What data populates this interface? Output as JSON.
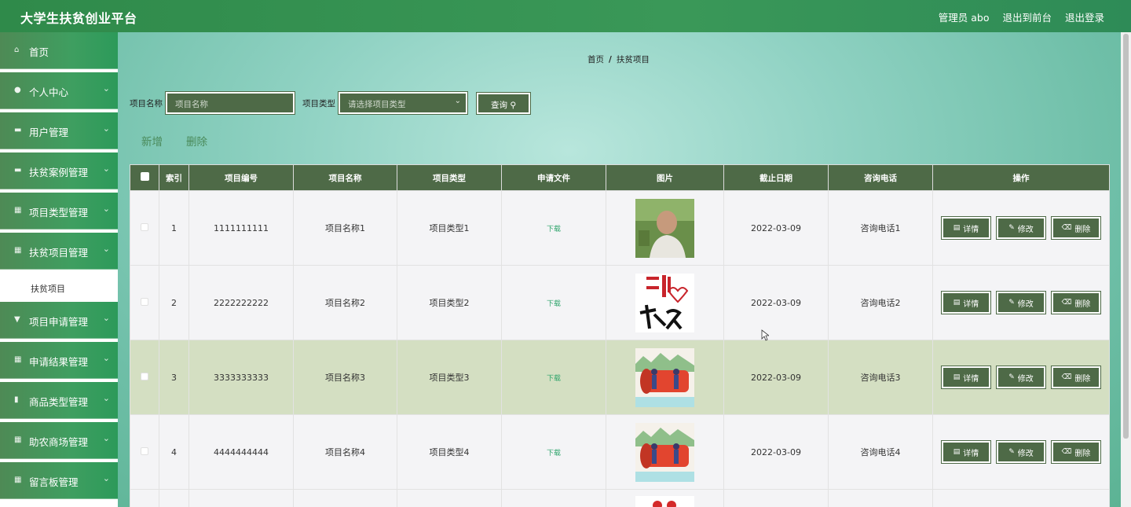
{
  "header": {
    "title": "大学生扶贫创业平台",
    "admin": "管理员 abo",
    "to_front": "退出到前台",
    "logout": "退出登录"
  },
  "sidebar": {
    "items": [
      {
        "label": "首页",
        "icon": "home-icon",
        "chev": false
      },
      {
        "label": "个人中心",
        "icon": "user-icon",
        "chev": true
      },
      {
        "label": "用户管理",
        "icon": "users-icon",
        "chev": true
      },
      {
        "label": "扶贫案例管理",
        "icon": "case-icon",
        "chev": true
      },
      {
        "label": "项目类型管理",
        "icon": "grid-icon",
        "chev": true
      },
      {
        "label": "扶贫项目管理",
        "icon": "grid-icon",
        "chev": true
      }
    ],
    "sub_item": "扶贫项目",
    "items_after": [
      {
        "label": "项目申请管理",
        "icon": "apply-icon",
        "chev": true
      },
      {
        "label": "申请结果管理",
        "icon": "grid-icon",
        "chev": true
      },
      {
        "label": "商品类型管理",
        "icon": "bag-icon",
        "chev": true
      },
      {
        "label": "助农商场管理",
        "icon": "grid-icon",
        "chev": true
      },
      {
        "label": "留言板管理",
        "icon": "grid-icon",
        "chev": true
      }
    ]
  },
  "breadcrumb": {
    "home": "首页",
    "sep": "/",
    "current": "扶贫项目"
  },
  "search": {
    "name_label": "项目名称",
    "name_placeholder": "项目名称",
    "type_label": "项目类型",
    "type_placeholder": "请选择项目类型",
    "query_button": "查询"
  },
  "toolbar": {
    "add": "新增",
    "delete": "删除"
  },
  "table": {
    "columns": [
      "索引",
      "项目编号",
      "项目名称",
      "项目类型",
      "申请文件",
      "图片",
      "截止日期",
      "咨询电话",
      "操作"
    ],
    "rows": [
      {
        "index": "1",
        "code": "1111111111",
        "name": "项目名称1",
        "type": "项目类型1",
        "file": "下载",
        "date": "2022-03-09",
        "phone": "咨询电话1",
        "image": "elderly-man-photo"
      },
      {
        "index": "2",
        "code": "2222222222",
        "name": "项目名称2",
        "type": "项目类型2",
        "file": "下载",
        "date": "2022-03-09",
        "phone": "咨询电话2",
        "image": "poverty-alleviation-calligraphy"
      },
      {
        "index": "3",
        "code": "3333333333",
        "name": "项目名称3",
        "type": "项目类型3",
        "file": "下载",
        "date": "2022-03-09",
        "phone": "咨询电话3",
        "image": "xiaokang-illustration"
      },
      {
        "index": "4",
        "code": "4444444444",
        "name": "项目名称4",
        "type": "项目类型4",
        "file": "下载",
        "date": "2022-03-09",
        "phone": "咨询电话4",
        "image": "xiaokang-illustration"
      }
    ],
    "op_detail": "详情",
    "op_edit": "修改",
    "op_delete": "删除"
  },
  "colors": {
    "primary": "#4e6a47",
    "header": "#2f8a4a",
    "highlight_row": "#d4dfc2",
    "link": "#2ea46b"
  }
}
